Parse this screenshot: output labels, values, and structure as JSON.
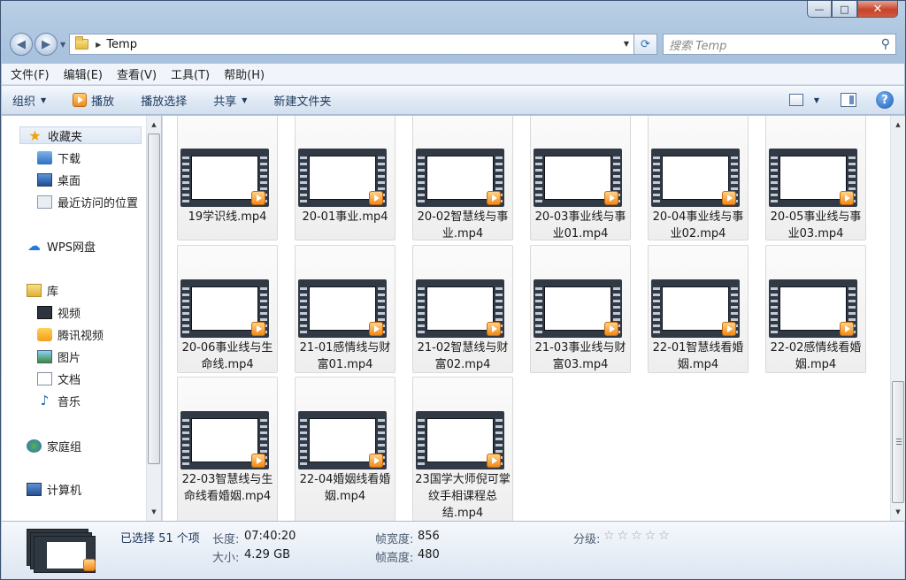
{
  "window": {
    "minimize": "—",
    "maximize": "□",
    "close": "✕"
  },
  "nav": {
    "back_icon": "back-arrow-icon",
    "forward_icon": "forward-arrow-icon",
    "address_path": "Temp",
    "search_placeholder": "搜索 Temp"
  },
  "menubar": [
    "文件(F)",
    "编辑(E)",
    "查看(V)",
    "工具(T)",
    "帮助(H)"
  ],
  "toolbar": {
    "organize": "组织",
    "play": "播放",
    "play_selection": "播放选择",
    "share": "共享",
    "new_folder": "新建文件夹"
  },
  "sidebar": {
    "items": [
      {
        "label": "收藏夹",
        "icon": "star-icon"
      },
      {
        "label": "下载",
        "icon": "download-folder-icon"
      },
      {
        "label": "桌面",
        "icon": "desktop-icon"
      },
      {
        "label": "最近访问的位置",
        "icon": "recent-places-icon"
      },
      {
        "label": "WPS网盘",
        "icon": "cloud-icon"
      },
      {
        "label": "库",
        "icon": "library-icon"
      },
      {
        "label": "视频",
        "icon": "video-library-icon"
      },
      {
        "label": "腾讯视频",
        "icon": "tencent-video-icon"
      },
      {
        "label": "图片",
        "icon": "pictures-icon"
      },
      {
        "label": "文档",
        "icon": "documents-icon"
      },
      {
        "label": "音乐",
        "icon": "music-icon"
      },
      {
        "label": "家庭组",
        "icon": "homegroup-icon"
      },
      {
        "label": "计算机",
        "icon": "computer-icon"
      }
    ]
  },
  "files": [
    {
      "name": "19学识线.mp4"
    },
    {
      "name": "20-01事业.mp4"
    },
    {
      "name": "20-02智慧线与事业.mp4"
    },
    {
      "name": "20-03事业线与事业01.mp4"
    },
    {
      "name": "20-04事业线与事业02.mp4"
    },
    {
      "name": "20-05事业线与事业03.mp4"
    },
    {
      "name": "20-06事业线与生命线.mp4"
    },
    {
      "name": "21-01感情线与财富01.mp4"
    },
    {
      "name": "21-02智慧线与财富02.mp4"
    },
    {
      "name": "21-03事业线与财富03.mp4"
    },
    {
      "name": "22-01智慧线看婚姻.mp4"
    },
    {
      "name": "22-02感情线看婚姻.mp4"
    },
    {
      "name": "22-03智慧线与生命线看婚姻.mp4"
    },
    {
      "name": "22-04婚姻线看婚姻.mp4"
    },
    {
      "name": "23国学大师倪可掌纹手相课程总结.mp4"
    }
  ],
  "details": {
    "selected": "已选择 51 个项",
    "length_label": "长度:",
    "length_value": "07:40:20",
    "size_label": "大小:",
    "size_value": "4.29 GB",
    "width_label": "帧宽度:",
    "width_value": "856",
    "height_label": "帧高度:",
    "height_value": "480",
    "rating_label": "分级:",
    "rating_stars": "☆☆☆☆☆",
    "rating_value": 0
  }
}
